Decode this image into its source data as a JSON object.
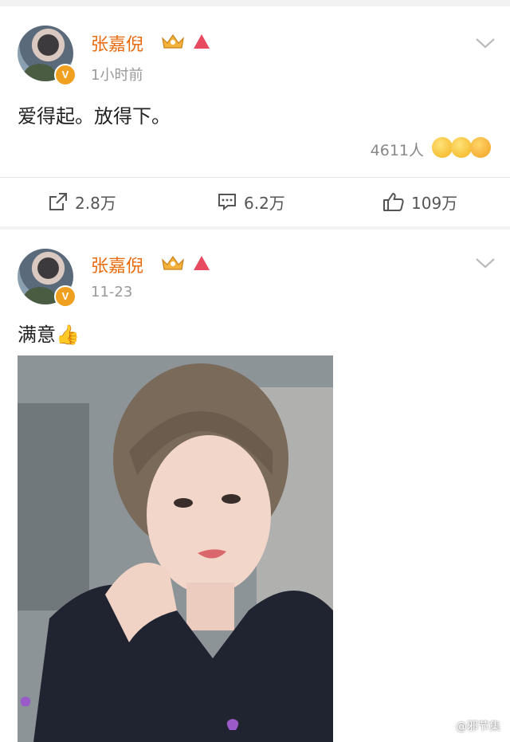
{
  "posts": [
    {
      "username": "张嘉倪",
      "time": "1小时前",
      "content": "爱得起。放得下。",
      "reaction_count": "4611人",
      "actions": {
        "repost": "2.8万",
        "comment": "6.2万",
        "like": "109万"
      }
    },
    {
      "username": "张嘉倪",
      "time": "11-23",
      "content": "满意👍",
      "photo_watermark": "@邪节集"
    }
  ],
  "colors": {
    "username": "#e86b10",
    "verified": "#f0a020",
    "background": "#f2f2f2"
  }
}
